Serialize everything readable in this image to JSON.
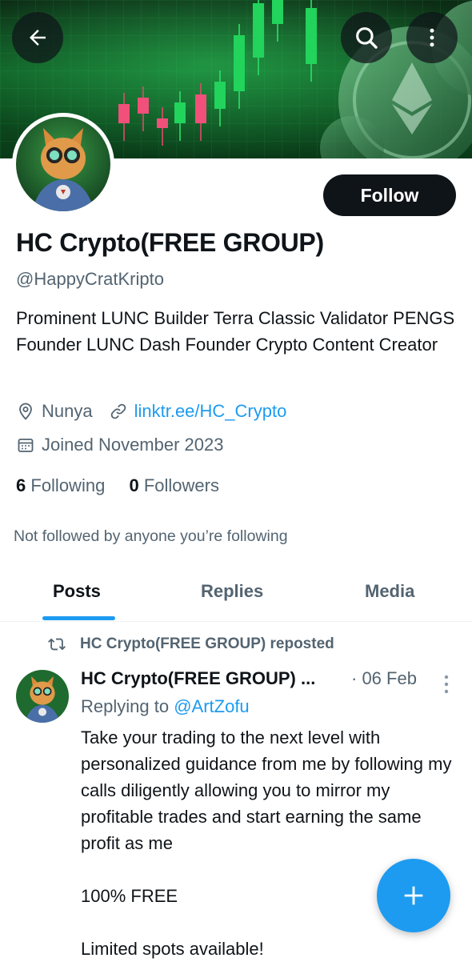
{
  "profile": {
    "name": "HC Crypto(FREE GROUP)",
    "handle": "@HappyCratKripto",
    "bio": "Prominent LUNC Builder Terra Classic Validator PENGS Founder LUNC Dash Founder Crypto Content Creator",
    "location": "Nunya",
    "link": "linktr.ee/HC_Crypto",
    "joined": "Joined November 2023",
    "following_count": "6",
    "following_label": "Following",
    "followers_count": "0",
    "followers_label": "Followers",
    "not_followed": "Not followed by anyone you’re following"
  },
  "header": {
    "back_icon": "arrow-left-icon",
    "search_icon": "search-icon",
    "more_icon": "more-vertical-icon"
  },
  "actions": {
    "follow_label": "Follow"
  },
  "tabs": [
    {
      "label": "Posts",
      "active": true
    },
    {
      "label": "Replies",
      "active": false
    },
    {
      "label": "Media",
      "active": false
    }
  ],
  "post": {
    "repost_label": "HC Crypto(FREE GROUP) reposted",
    "author": "HC Crypto(FREE GROUP) ...",
    "date": "· 06 Feb",
    "replying_prefix": "Replying to",
    "replying_to": "@ArtZofu",
    "text_1": "Take your trading to the next level with personalized guidance from me by following my calls diligently allowing you to mirror my profitable trades and start earning the same profit as me",
    "text_2": "100% FREE",
    "text_3": "Limited spots available!"
  },
  "colors": {
    "accent": "#1d9bf0",
    "text": "#0f1419",
    "muted": "#536471",
    "banner": "#0f5a24"
  }
}
